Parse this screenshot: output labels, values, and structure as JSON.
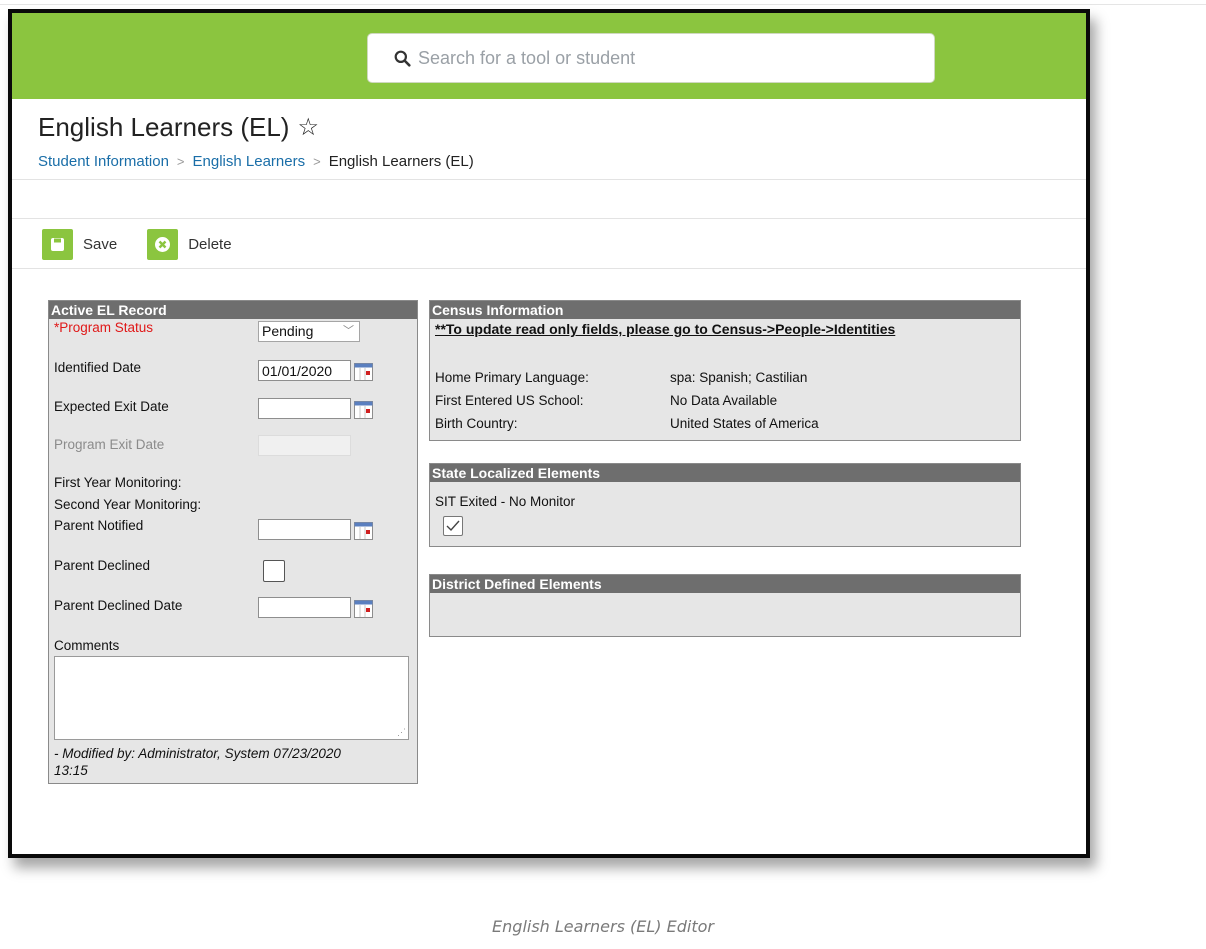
{
  "search": {
    "placeholder": "Search for a tool or student"
  },
  "page": {
    "title": "English Learners (EL)",
    "star": "☆"
  },
  "breadcrumb": {
    "items": [
      {
        "label": "Student Information"
      },
      {
        "label": "English Learners"
      }
    ],
    "current": "English Learners (EL)",
    "separator": ">"
  },
  "toolbar": {
    "save_label": "Save",
    "delete_label": "Delete"
  },
  "active_el": {
    "title": "Active EL Record",
    "program_status_label": "*Program Status",
    "program_status_value": "Pending",
    "identified_date_label": "Identified Date",
    "identified_date_value": "01/01/2020",
    "expected_exit_label": "Expected Exit Date",
    "expected_exit_value": "",
    "program_exit_label": "Program Exit Date",
    "program_exit_value": "",
    "first_year_label": "First Year Monitoring:",
    "second_year_label": "Second Year Monitoring:",
    "parent_notified_label": "Parent Notified",
    "parent_notified_value": "",
    "parent_declined_label": "Parent Declined",
    "parent_declined_checked": false,
    "parent_declined_date_label": "Parent Declined Date",
    "parent_declined_date_value": "",
    "comments_label": "Comments",
    "comments_value": "",
    "modified_line1": "- Modified by: Administrator, System 07/23/2020",
    "modified_line2": "13:15"
  },
  "census": {
    "title": "Census Information",
    "link": "**To update read only fields, please go to Census->People->Identities",
    "rows": [
      {
        "label": "Home Primary Language:",
        "value": "spa: Spanish; Castilian"
      },
      {
        "label": "First Entered US School:",
        "value": "No Data Available"
      },
      {
        "label": "Birth Country:",
        "value": "United States of America"
      }
    ]
  },
  "state_elements": {
    "title": "State Localized Elements",
    "sit_label": "SIT Exited - No Monitor",
    "sit_checked": true
  },
  "district_elements": {
    "title": "District Defined Elements"
  },
  "caption": "English Learners (EL) Editor",
  "colors": {
    "brand_green": "#8bc53f",
    "panel_header": "#6e6e6e",
    "link_blue": "#1a6ea8",
    "required_red": "#e01818"
  }
}
